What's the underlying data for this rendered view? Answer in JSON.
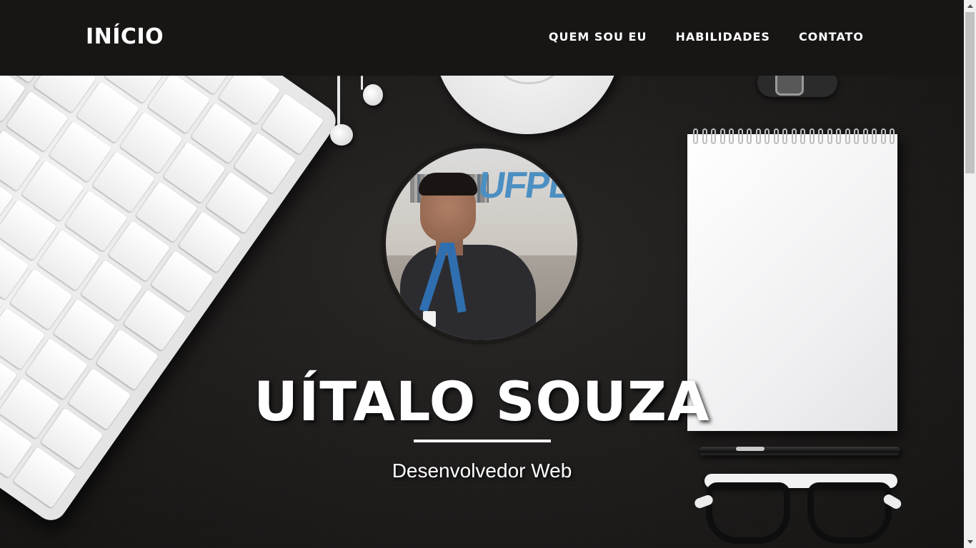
{
  "navbar": {
    "brand": "INÍCIO",
    "links": [
      {
        "label": "QUEM SOU EU"
      },
      {
        "label": "HABILIDADES"
      },
      {
        "label": "CONTATO"
      }
    ]
  },
  "hero": {
    "name": "UÍTALO SOUZA",
    "subtitle": "Desenvolvedor Web",
    "avatar_icon": "profile-photo"
  },
  "colors": {
    "navbar_bg": "#181615",
    "text": "#ffffff",
    "background": "#1c1a19"
  }
}
